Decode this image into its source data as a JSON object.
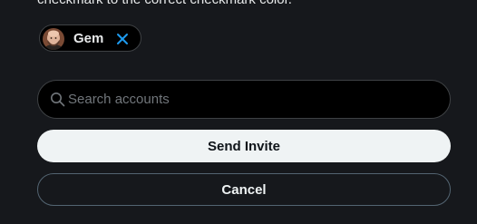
{
  "header": {
    "cut_text": "checkmark to the correct checkmark color."
  },
  "selected_accounts": [
    {
      "name": "Gem",
      "avatar": "bald-man-avatar",
      "remove_icon": "close-icon"
    }
  ],
  "search": {
    "placeholder": "Search accounts",
    "value": "",
    "icon": "search-icon"
  },
  "buttons": {
    "send_invite": "Send Invite",
    "cancel": "Cancel"
  },
  "colors": {
    "background": "#16181c",
    "text": "#e7e9ea",
    "muted": "#71767b",
    "accent": "#1d9bf0",
    "primary_button_bg": "#eff3f4",
    "primary_button_text": "#0f1419",
    "border": "#3e4144"
  }
}
